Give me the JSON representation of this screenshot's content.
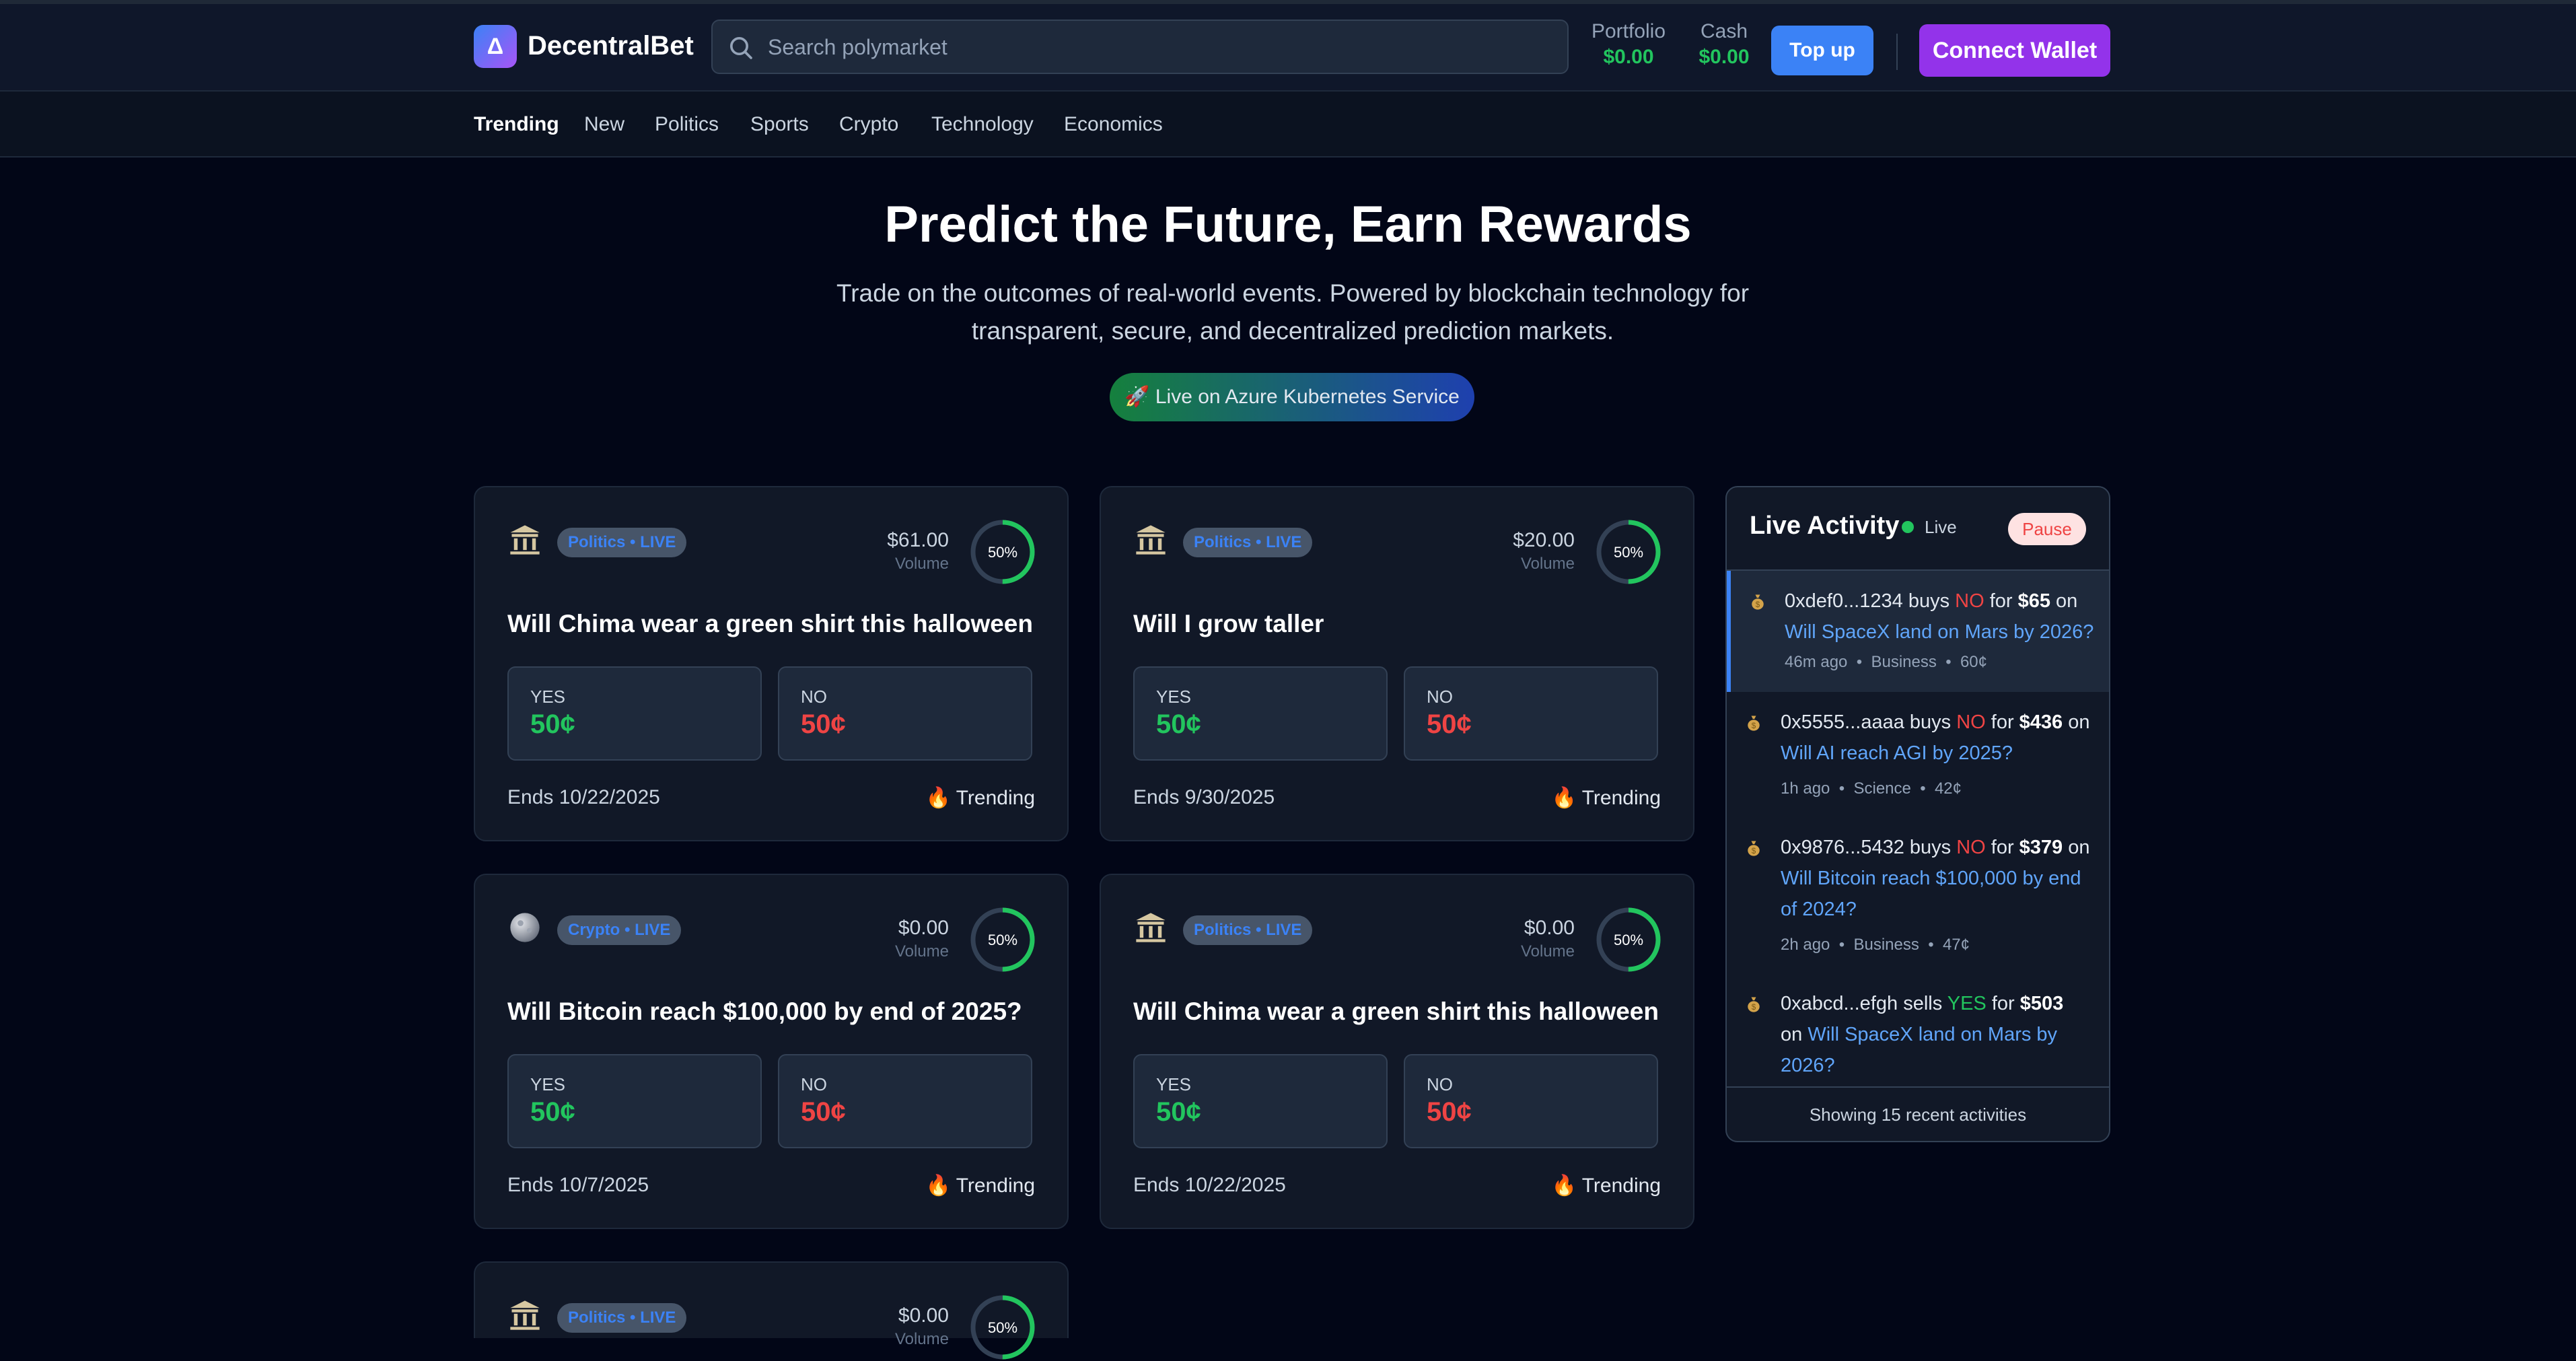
{
  "header": {
    "logo_glyph": "Δ",
    "brand": "DecentralBet",
    "search_placeholder": "Search polymarket",
    "portfolio": {
      "label": "Portfolio",
      "value": "$0.00"
    },
    "cash": {
      "label": "Cash",
      "value": "$0.00"
    },
    "topup_label": "Top up",
    "connect_label": "Connect Wallet"
  },
  "nav": [
    "Trending",
    "New",
    "Politics",
    "Sports",
    "Crypto",
    "Technology",
    "Economics"
  ],
  "hero": {
    "title": "Predict the Future, Earn Rewards",
    "subtitle": "Trade on the outcomes of real-world events. Powered by blockchain technology for transparent, secure, and decentralized prediction markets.",
    "badge": "🚀 Live on Azure Kubernetes Service"
  },
  "cards": [
    {
      "icon": "bank-icon",
      "tag": "Politics • LIVE",
      "volume": "$61.00",
      "volume_label": "Volume",
      "percent": "50%",
      "title": "Will Chima wear a green shirt this halloween",
      "yes_label": "YES",
      "yes_price": "50¢",
      "no_label": "NO",
      "no_price": "50¢",
      "ends": "Ends 10/22/2025",
      "trend": "🔥 Trending"
    },
    {
      "icon": "bank-icon",
      "tag": "Politics • LIVE",
      "volume": "$20.00",
      "volume_label": "Volume",
      "percent": "50%",
      "title": "Will I grow taller",
      "yes_label": "YES",
      "yes_price": "50¢",
      "no_label": "NO",
      "no_price": "50¢",
      "ends": "Ends 9/30/2025",
      "trend": "🔥 Trending"
    },
    {
      "icon": "coin-icon",
      "tag": "Crypto • LIVE",
      "volume": "$0.00",
      "volume_label": "Volume",
      "percent": "50%",
      "title": "Will Bitcoin reach $100,000 by end of 2025?",
      "yes_label": "YES",
      "yes_price": "50¢",
      "no_label": "NO",
      "no_price": "50¢",
      "ends": "Ends 10/7/2025",
      "trend": "🔥 Trending"
    },
    {
      "icon": "bank-icon",
      "tag": "Politics • LIVE",
      "volume": "$0.00",
      "volume_label": "Volume",
      "percent": "50%",
      "title": "Will Chima wear a green shirt this halloween",
      "yes_label": "YES",
      "yes_price": "50¢",
      "no_label": "NO",
      "no_price": "50¢",
      "ends": "Ends 10/22/2025",
      "trend": "🔥 Trending"
    },
    {
      "icon": "bank-icon",
      "tag": "Politics • LIVE",
      "volume": "$0.00",
      "volume_label": "Volume",
      "percent": "50%"
    }
  ],
  "activity": {
    "title": "Live Activity",
    "live_label": "Live",
    "pause_label": "Pause",
    "items": [
      {
        "user": "0xdef0...1234",
        "verb": " buys ",
        "side": "NO",
        "for": " for ",
        "amount": "$65",
        "on": " on ",
        "market": "Will SpaceX land on Mars by 2026?",
        "time": "46m ago",
        "category": "Business",
        "price": "60¢"
      },
      {
        "user": "0x5555...aaaa",
        "verb": " buys ",
        "side": "NO",
        "for": " for ",
        "amount": "$436",
        "on": " on ",
        "market": "Will AI reach AGI by 2025?",
        "time": "1h ago",
        "category": "Science",
        "price": "42¢"
      },
      {
        "user": "0x9876...5432",
        "verb": " buys ",
        "side": "NO",
        "for": " for ",
        "amount": "$379",
        "on": " on ",
        "market": "Will Bitcoin reach $100,000 by end of 2024?",
        "time": "2h ago",
        "category": "Business",
        "price": "47¢"
      },
      {
        "user": "0xabcd...efgh",
        "verb": " sells ",
        "side": "YES",
        "for": " for ",
        "amount": "$503",
        "on": " on ",
        "market": "Will SpaceX land on Mars by 2026?"
      }
    ],
    "footer": "Showing 15 recent activities"
  },
  "colors": {
    "yes": "#22c55e",
    "no": "#ef4444",
    "accent": "#3b82f6",
    "connect": "#9333ea"
  }
}
